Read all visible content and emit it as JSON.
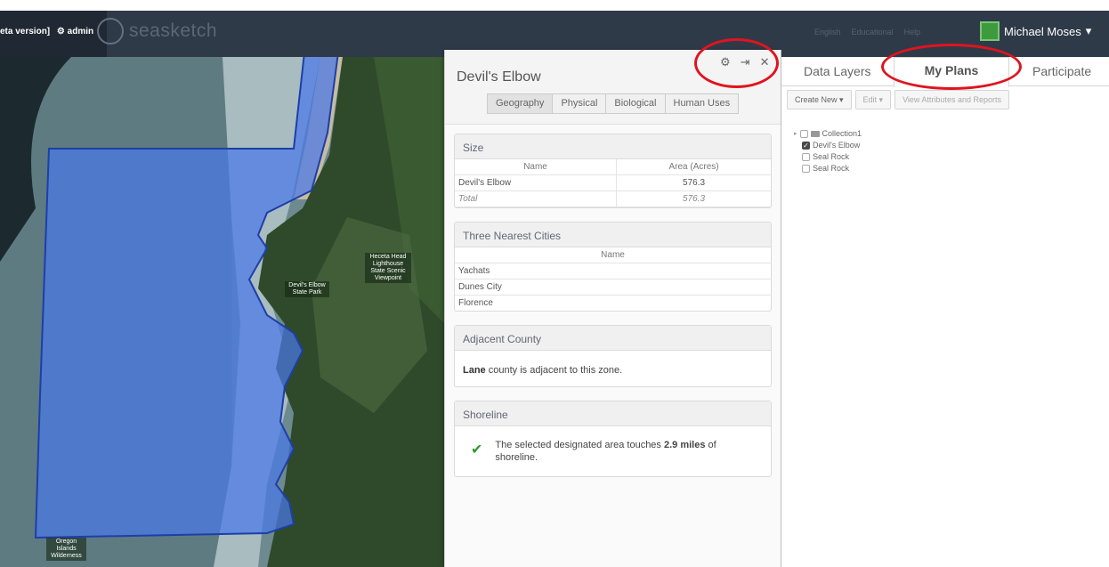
{
  "header": {
    "beta_text": "eta version]",
    "admin_label": "admin",
    "logo_text": "seasketch",
    "links": [
      "English",
      "Educational",
      "Help"
    ],
    "user_name": "Michael Moses"
  },
  "map": {
    "labels": {
      "heceta": "Heceta Head Lighthouse State Scenic Viewpoint",
      "devils_park": "Devil's Elbow State Park",
      "wilderness": "Oregon Islands Wilderness"
    }
  },
  "panel": {
    "title": "Devil's Elbow",
    "tabs": [
      "Geography",
      "Physical",
      "Biological",
      "Human Uses"
    ],
    "size": {
      "heading": "Size",
      "columns": [
        "Name",
        "Area (Acres)"
      ],
      "rows": [
        [
          "Devil's Elbow",
          "576.3"
        ]
      ],
      "total_label": "Total",
      "total_value": "576.3"
    },
    "cities": {
      "heading": "Three Nearest Cities",
      "column": "Name",
      "rows": [
        "Yachats",
        "Dunes City",
        "Florence"
      ]
    },
    "county": {
      "heading": "Adjacent County",
      "county_name": "Lane",
      "text": "county is adjacent to this zone."
    },
    "shoreline": {
      "heading": "Shoreline",
      "text_before": "The selected designated area touches",
      "miles": "2.9 miles",
      "text_after": "of shoreline."
    }
  },
  "right": {
    "tabs": [
      "Data Layers",
      "My Plans",
      "Participate"
    ],
    "active_tab": "My Plans",
    "toolbar": [
      "Create New ▾",
      "Edit ▾",
      "View Attributes and Reports"
    ],
    "tree": [
      {
        "label": "Collection1",
        "checked": false,
        "folder": true
      },
      {
        "label": "Devil's Elbow",
        "checked": true,
        "folder": false
      },
      {
        "label": "Seal Rock",
        "checked": false,
        "folder": false
      },
      {
        "label": "Seal Rock",
        "checked": false,
        "folder": false
      }
    ]
  },
  "colors": {
    "header_bg": "#2f3a48",
    "selection_fill": "#4a78e8",
    "highlight_ring": "#e0141e"
  }
}
